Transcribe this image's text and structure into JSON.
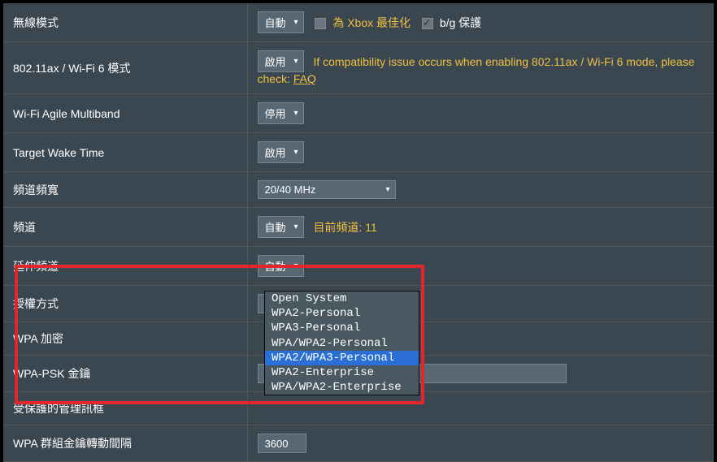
{
  "rows": {
    "wireless_mode": {
      "label": "無線模式",
      "select": "自動",
      "xbox_label": "為 Xbox 最佳化",
      "xbox_checked": false,
      "bg_label": "b/g 保護",
      "bg_checked": true
    },
    "ax_mode": {
      "label": "802.11ax / Wi-Fi 6 模式",
      "select": "啟用",
      "note_prefix": "If compatibility issue occurs when enabling 802.11ax / Wi-Fi 6 mode, please check: ",
      "faq": "FAQ"
    },
    "agile": {
      "label": "Wi-Fi Agile Multiband",
      "select": "停用"
    },
    "twt": {
      "label": "Target Wake Time",
      "select": "啟用"
    },
    "bandwidth": {
      "label": "頻道頻寬",
      "select": "20/40 MHz"
    },
    "channel": {
      "label": "頻道",
      "select": "自動",
      "note": "目前頻道: 11"
    },
    "ext_channel": {
      "label": "延伸頻道",
      "select": "自動"
    },
    "auth": {
      "label": "授權方式",
      "select": "WPA2-Personal",
      "options": [
        "Open System",
        "WPA2-Personal",
        "WPA3-Personal",
        "WPA/WPA2-Personal",
        "WPA2/WPA3-Personal",
        "WPA2-Enterprise",
        "WPA/WPA2-Enterprise"
      ],
      "hovered": "WPA2/WPA3-Personal"
    },
    "wpa_enc": {
      "label": "WPA 加密"
    },
    "psk": {
      "label": "WPA-PSK 金鑰",
      "value": ""
    },
    "pmf": {
      "label": "受保護的管理訊框"
    },
    "rekey": {
      "label": "WPA 群組金鑰轉動間隔",
      "value": "3600"
    }
  }
}
